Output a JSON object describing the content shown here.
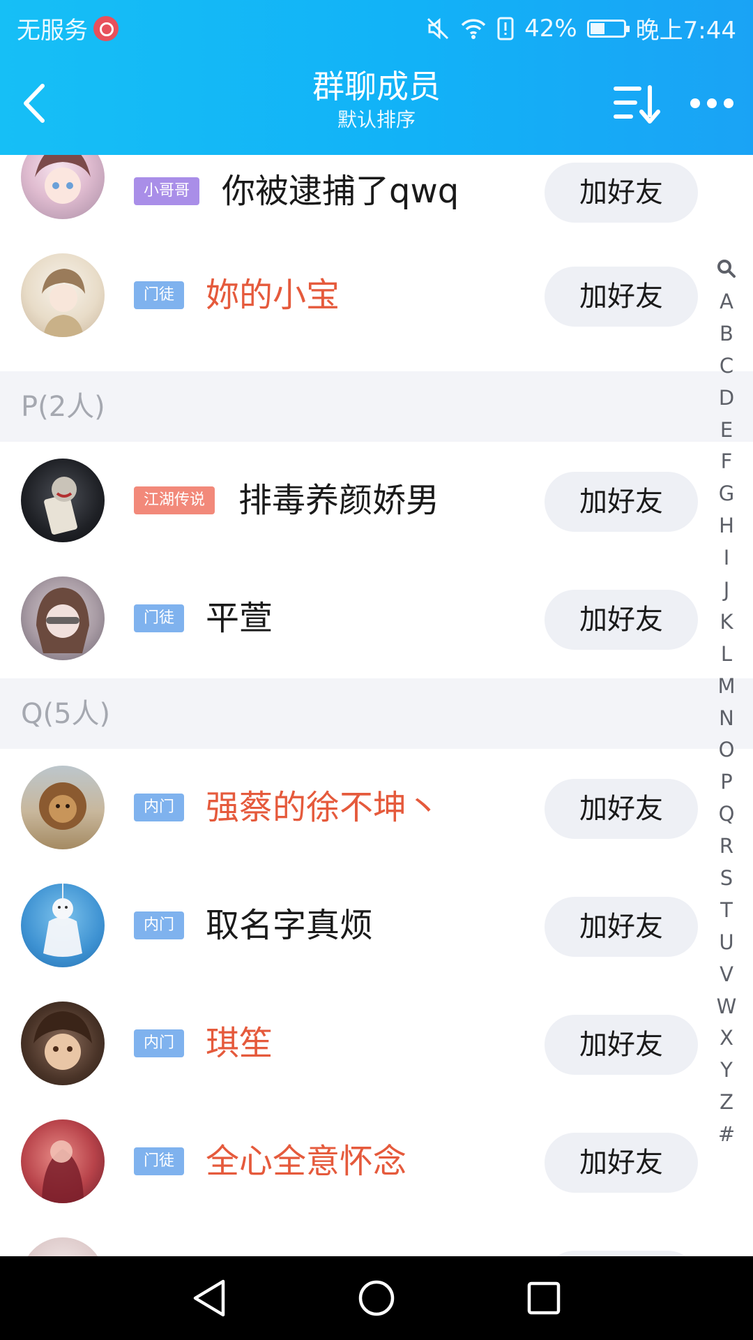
{
  "status_bar": {
    "carrier": "无服务",
    "battery": "42%",
    "time": "晚上7:44"
  },
  "header": {
    "title": "群聊成员",
    "subtitle": "默认排序"
  },
  "members": [
    {
      "badge": "小哥哥",
      "badge_color": "#a98ee8",
      "name": "你被逮捕了qwq",
      "name_color": "#1a1a1a",
      "add_label": "加好友"
    },
    {
      "badge": "门徒",
      "badge_color": "#7fb2ee",
      "name": "妳的小宝",
      "name_color": "#e55a3c",
      "add_label": "加好友"
    },
    {
      "badge": "江湖传说",
      "badge_color": "#f2897a",
      "name": "排毒养颜娇男",
      "name_color": "#1a1a1a",
      "add_label": "加好友"
    },
    {
      "badge": "门徒",
      "badge_color": "#7fb2ee",
      "name": "平萱",
      "name_color": "#1a1a1a",
      "add_label": "加好友"
    },
    {
      "badge": "内门",
      "badge_color": "#7fb2ee",
      "name": "强蔡的徐不坤丶",
      "name_color": "#e55a3c",
      "add_label": "加好友"
    },
    {
      "badge": "内门",
      "badge_color": "#7fb2ee",
      "name": "取名字真烦",
      "name_color": "#1a1a1a",
      "add_label": "加好友"
    },
    {
      "badge": "内门",
      "badge_color": "#7fb2ee",
      "name": "琪笙",
      "name_color": "#e55a3c",
      "add_label": "加好友"
    },
    {
      "badge": "门徒",
      "badge_color": "#7fb2ee",
      "name": "全心全意怀念",
      "name_color": "#e55a3c",
      "add_label": "加好友"
    }
  ],
  "sections": [
    {
      "label": "P(2人)"
    },
    {
      "label": "Q(5人)"
    }
  ],
  "index_letters": [
    "A",
    "B",
    "C",
    "D",
    "E",
    "F",
    "G",
    "H",
    "I",
    "J",
    "K",
    "L",
    "M",
    "N",
    "O",
    "P",
    "Q",
    "R",
    "S",
    "T",
    "U",
    "V",
    "W",
    "X",
    "Y",
    "Z",
    "#"
  ],
  "icons": {
    "back": "chevron-left-icon",
    "sort": "sort-icon",
    "more": "more-icon",
    "index_search": "search-icon"
  }
}
